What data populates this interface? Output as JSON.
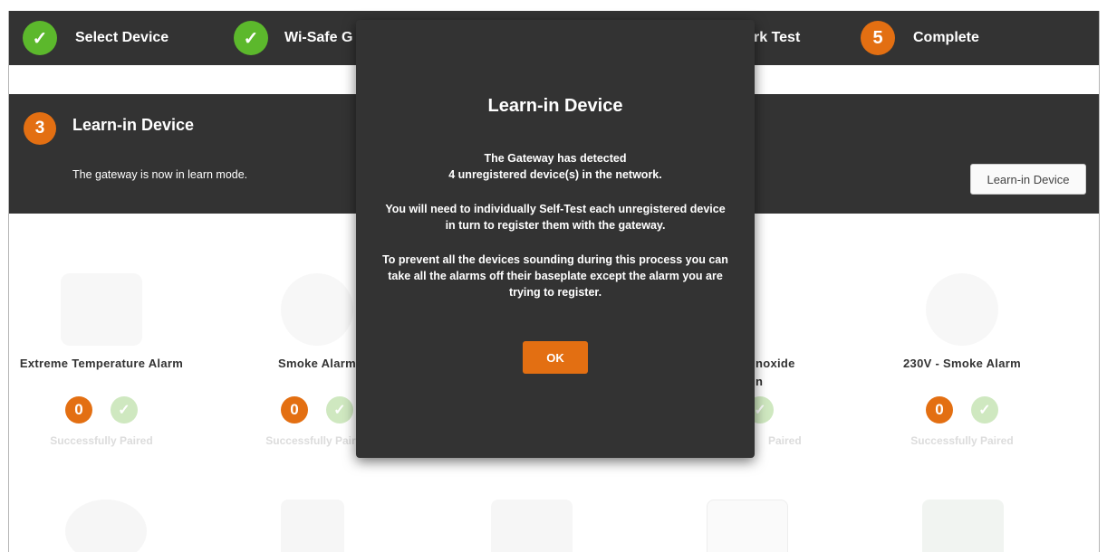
{
  "steps": [
    {
      "label": "Select Device",
      "state": "done"
    },
    {
      "label": "Wi-Safe G",
      "state": "done"
    },
    {
      "label": "rk Test",
      "state": "hidden"
    },
    {
      "label": "Complete",
      "number": "5",
      "state": "pending"
    }
  ],
  "section": {
    "number": "3",
    "title": "Learn-in Device",
    "description": "The gateway is now in learn mode.",
    "learn_button": "Learn-in Device"
  },
  "devices": [
    {
      "name": "Extreme Temperature Alarm",
      "count": "0",
      "status": "Successfully Paired"
    },
    {
      "name": "Smoke Alarm",
      "count": "0",
      "status": "Successfully Paired"
    },
    {
      "name": "noxide\nn",
      "count": "",
      "status": "Paired"
    },
    {
      "name": "230V - Smoke Alarm",
      "count": "0",
      "status": "Successfully Paired"
    }
  ],
  "modal": {
    "title": "Learn-in Device",
    "line1": "The Gateway has detected",
    "line2": "4 unregistered device(s) in the network.",
    "para2": "You will need to individually Self-Test each unregistered device in turn to register them with the gateway.",
    "para3": "To prevent all the devices sounding during this process you can take all the alarms off their baseplate except the alarm you are trying to register.",
    "ok_label": "OK"
  },
  "colors": {
    "bar": "#333333",
    "accent_orange": "#e36f12",
    "check_green": "#5cb82c"
  },
  "icons": {
    "step_done": "check-icon",
    "paired": "check-circle-icon"
  }
}
